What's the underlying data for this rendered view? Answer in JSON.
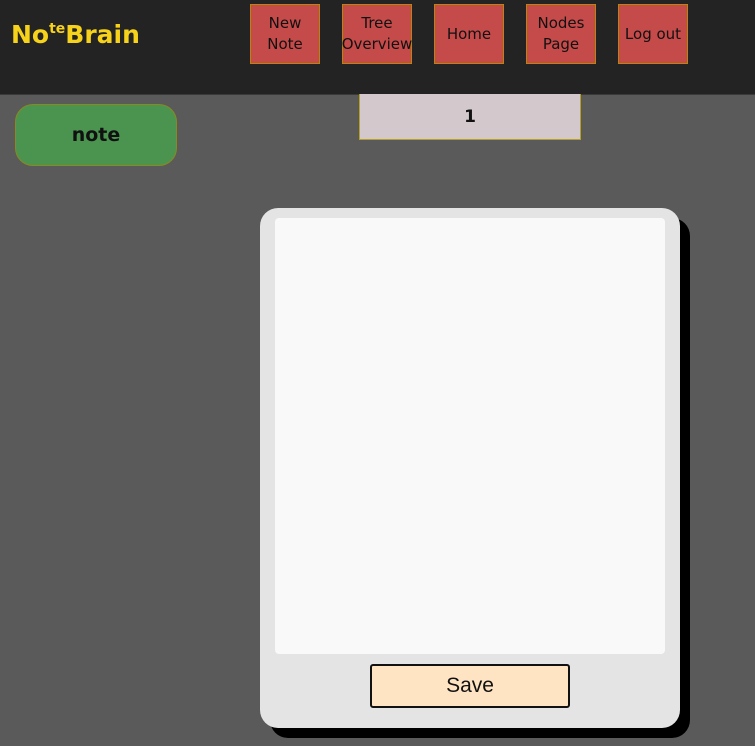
{
  "header": {
    "brand_prefix": "No",
    "brand_sup": "te",
    "brand_suffix": "Brain",
    "nav": [
      {
        "line1": "New",
        "line2": "Note"
      },
      {
        "line1": "Tree",
        "line2": "Overview"
      },
      {
        "line1": "Home",
        "line2": ""
      },
      {
        "line1": "Nodes",
        "line2": "Page"
      },
      {
        "line1": "Log out",
        "line2": ""
      }
    ]
  },
  "sidebar": {
    "note_label": "note"
  },
  "note": {
    "title_value": "1",
    "body_value": "",
    "save_label": "Save"
  },
  "colors": {
    "brand": "#f7d21a",
    "nav_button": "#c54a4a",
    "note_tag": "#4a9450",
    "save_button": "#ffe4c4"
  }
}
